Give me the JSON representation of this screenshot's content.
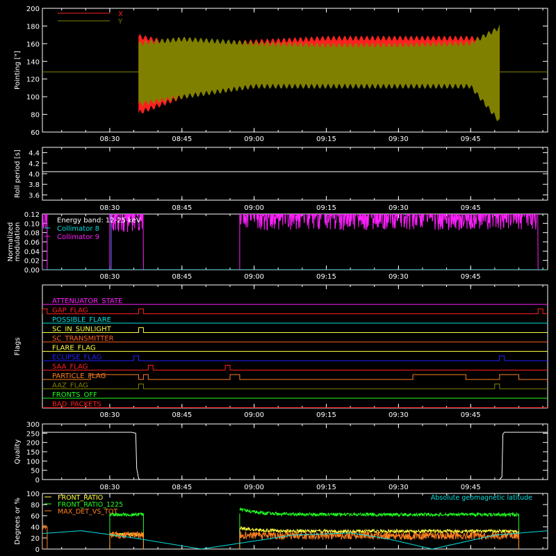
{
  "chart_data": [
    {
      "id": "pointing",
      "type": "line",
      "ylabel": "Pointing [\"]",
      "ylim": [
        60,
        200
      ],
      "yticks": [
        60,
        80,
        100,
        120,
        140,
        160,
        180,
        200
      ],
      "x_range": [
        "08:16",
        "10:01"
      ],
      "xticks": [
        "08:30",
        "08:45",
        "09:00",
        "09:15",
        "09:30",
        "09:45"
      ],
      "legend": {
        "placement": "top-left",
        "entries": [
          {
            "name": "X",
            "color": "#ff2020"
          },
          {
            "name": "Y",
            "color": "#808000"
          }
        ]
      },
      "series": [
        {
          "name": "X",
          "color": "#ff2020",
          "flat_value": 128,
          "active_start": "08:36",
          "active_end": "09:51",
          "envelope": [
            {
              "t": "08:36",
              "lo": 82,
              "hi": 168
            },
            {
              "t": "08:45",
              "lo": 100,
              "hi": 158
            },
            {
              "t": "09:00",
              "lo": 115,
              "hi": 162
            },
            {
              "t": "09:15",
              "lo": 120,
              "hi": 166
            },
            {
              "t": "09:30",
              "lo": 118,
              "hi": 166
            },
            {
              "t": "09:45",
              "lo": 118,
              "hi": 166
            },
            {
              "t": "09:51",
              "lo": 115,
              "hi": 162
            }
          ]
        },
        {
          "name": "Y",
          "color": "#808000",
          "flat_value": 128,
          "active_start": "08:36",
          "active_end": "09:51",
          "envelope": [
            {
              "t": "08:36",
              "lo": 92,
              "hi": 160
            },
            {
              "t": "08:45",
              "lo": 100,
              "hi": 165
            },
            {
              "t": "09:00",
              "lo": 112,
              "hi": 160
            },
            {
              "t": "09:15",
              "lo": 112,
              "hi": 158
            },
            {
              "t": "09:30",
              "lo": 112,
              "hi": 158
            },
            {
              "t": "09:45",
              "lo": 112,
              "hi": 160
            },
            {
              "t": "09:51",
              "lo": 72,
              "hi": 178
            }
          ]
        }
      ]
    },
    {
      "id": "roll",
      "type": "line",
      "ylabel": "Roll period [s]",
      "ylim": [
        3.5,
        4.5
      ],
      "yticks": [
        3.6,
        3.8,
        4.0,
        4.2,
        4.4
      ],
      "ytick_labels": [
        "3.6",
        "3.8",
        "4.0",
        "4.2",
        "4.4"
      ],
      "xticks": [
        "08:30",
        "08:45",
        "09:00",
        "09:15",
        "09:30",
        "09:45"
      ],
      "series": [
        {
          "name": "",
          "color": "#ffffff",
          "value": 4.04
        }
      ]
    },
    {
      "id": "modulation",
      "type": "line",
      "ylabel": "Normalized modulation",
      "ylabel_lines": [
        "Normalized",
        "modulation"
      ],
      "ylim": [
        0,
        0.12
      ],
      "yticks": [
        0,
        0.02,
        0.04,
        0.06,
        0.08,
        0.1,
        0.12
      ],
      "ytick_labels": [
        "0.00",
        "0.02",
        "0.04",
        "0.06",
        "0.08",
        "0.10",
        "0.12"
      ],
      "xticks": [
        "08:30",
        "08:45",
        "09:00",
        "09:15",
        "09:30",
        "09:45"
      ],
      "legend": {
        "placement": "top-left",
        "entries": [
          {
            "name": "Energy band: 12-25 keV",
            "color": "#ffffff"
          },
          {
            "name": "Collimator 8",
            "color": "#00e0e0"
          },
          {
            "name": "Collimator 9",
            "color": "#ff20ff"
          }
        ]
      },
      "segments": [
        {
          "series": "Collimator 9",
          "color": "#ff20ff",
          "start": "08:16",
          "end": "08:17",
          "lo": 0.085,
          "hi": 0.12
        },
        {
          "series": "Collimator 9",
          "color": "#ff20ff",
          "start": "08:30",
          "end": "08:37",
          "lo": 0.08,
          "hi": 0.12
        },
        {
          "series": "Collimator 9",
          "color": "#ff20ff",
          "start": "08:57",
          "end": "09:59",
          "lo": 0.085,
          "hi": 0.12
        },
        {
          "series": "Collimator 8",
          "color": "#00e0e0",
          "start": "08:16",
          "end": "10:01",
          "value": 0.0
        }
      ]
    },
    {
      "id": "flags",
      "type": "line",
      "ylabel": "Flags",
      "xticks": [
        "08:30",
        "08:45",
        "09:00",
        "09:15",
        "09:30",
        "09:45"
      ],
      "flags": [
        {
          "name": "ATTENUATOR_STATE",
          "color": "#ff20ff",
          "transitions": []
        },
        {
          "name": "GAP_FLAG",
          "color": "#ff2020",
          "transitions": [
            "08:16",
            "08:17",
            "08:36",
            "08:37",
            "09:59",
            "10:00"
          ]
        },
        {
          "name": "POSSIBLE_FLARE",
          "color": "#00e0e0",
          "transitions": []
        },
        {
          "name": "SC_IN_SUNLIGHT",
          "color": "#ffff40",
          "transitions": [
            "08:36",
            "08:37"
          ]
        },
        {
          "name": "SC_TRANSMITTER",
          "color": "#ff6020",
          "transitions": []
        },
        {
          "name": "FLARE_FLAG",
          "color": "#ffff40",
          "transitions": []
        },
        {
          "name": "ECLIPSE_FLAG",
          "color": "#2020ff",
          "transitions": [
            "08:35",
            "08:36",
            "09:51",
            "09:52"
          ]
        },
        {
          "name": "SAA_FLAG",
          "color": "#ff2020",
          "transitions": [
            "08:38",
            "08:39",
            "08:54",
            "08:55"
          ]
        },
        {
          "name": "PARTICLE_FLAG",
          "color": "#ff8020",
          "transitions": [
            "08:26",
            "08:36",
            "08:37",
            "08:38",
            "08:55",
            "08:57",
            "09:33",
            "09:44",
            "09:51",
            "09:55"
          ]
        },
        {
          "name": "AAZ_FLAG",
          "color": "#808000",
          "transitions": [
            "08:36",
            "08:37",
            "09:50",
            "09:51"
          ]
        },
        {
          "name": "FRONTS_OFF",
          "color": "#20ff20",
          "transitions": []
        },
        {
          "name": "BAD_PACKETS",
          "color": "#ff2020",
          "transitions": []
        }
      ]
    },
    {
      "id": "quality",
      "type": "line",
      "ylabel": "Quality",
      "ylim": [
        0,
        300
      ],
      "yticks": [
        0,
        50,
        100,
        150,
        200,
        250,
        300
      ],
      "ytick_labels": [
        "0",
        "50",
        "100",
        "150",
        "200",
        "250",
        "300"
      ],
      "xticks": [
        "08:30",
        "08:45",
        "09:00",
        "09:15",
        "09:30",
        "09:45"
      ],
      "series": [
        {
          "name": "",
          "color": "#ffffff",
          "points": [
            {
              "t": "08:16",
              "y": 255
            },
            {
              "t": "08:34.5",
              "y": 255
            },
            {
              "t": "08:35.4",
              "y": 250
            },
            {
              "t": "08:35.6",
              "y": 60
            },
            {
              "t": "08:36",
              "y": 5
            },
            {
              "t": "08:36.3",
              "y": 0
            },
            {
              "t": "09:51",
              "y": 0
            },
            {
              "t": "09:51.5",
              "y": 15
            },
            {
              "t": "09:51.7",
              "y": 245
            },
            {
              "t": "09:52",
              "y": 255
            },
            {
              "t": "10:01",
              "y": 255
            }
          ]
        }
      ]
    },
    {
      "id": "ratios",
      "type": "line",
      "ylabel": "Degrees or %",
      "ylim": [
        0,
        100
      ],
      "yticks": [
        0,
        20,
        40,
        60,
        80,
        100
      ],
      "ytick_labels": [
        "0",
        "20",
        "40",
        "60",
        "80",
        "100"
      ],
      "xticks": [
        "08:30",
        "08:45",
        "09:00",
        "09:15",
        "09:30",
        "09:45"
      ],
      "legend": {
        "placement": "top-left",
        "entries": [
          {
            "name": "FRONT_RATIO",
            "color": "#ffff40"
          },
          {
            "name": "FRONT_RATIO_1225",
            "color": "#20ff20"
          },
          {
            "name": "MAX_DET_VS_TOT",
            "color": "#ff8020"
          }
        ]
      },
      "annotation": {
        "text": "Absolute geomagnetic latitude",
        "color": "#00e0e0",
        "placement": "top-right"
      },
      "series": [
        {
          "name": "FRONT_RATIO_1225",
          "color": "#20ff20",
          "segments": [
            {
              "start": "08:30",
              "end": "08:37",
              "level": 62,
              "noise": 3
            },
            {
              "start": "08:57",
              "end": "09:55",
              "level": 62,
              "noise": 3,
              "start_level": 72
            }
          ]
        },
        {
          "name": "FRONT_RATIO",
          "color": "#ffff40",
          "segments": [
            {
              "start": "08:30",
              "end": "08:37",
              "level": 26,
              "noise": 3
            },
            {
              "start": "08:57",
              "end": "09:55",
              "level": 32,
              "noise": 3,
              "start_level": 38
            }
          ]
        },
        {
          "name": "MAX_DET_VS_TOT",
          "color": "#ff8020",
          "segments": [
            {
              "start": "08:16",
              "end": "08:17",
              "level": 38,
              "noise": 6
            },
            {
              "start": "08:30",
              "end": "08:37",
              "level": 25,
              "noise": 6
            },
            {
              "start": "08:57",
              "end": "09:55",
              "level": 24,
              "noise": 7
            }
          ]
        },
        {
          "name": "Absolute geomagnetic latitude",
          "color": "#00e0e0",
          "points": [
            {
              "t": "08:16",
              "y": 28
            },
            {
              "t": "08:24",
              "y": 33
            },
            {
              "t": "08:35",
              "y": 20
            },
            {
              "t": "08:49",
              "y": 0
            },
            {
              "t": "09:02",
              "y": 17
            },
            {
              "t": "09:08",
              "y": 25
            },
            {
              "t": "09:20",
              "y": 29
            },
            {
              "t": "09:28",
              "y": 18
            },
            {
              "t": "09:37",
              "y": 0
            },
            {
              "t": "09:50",
              "y": 25
            },
            {
              "t": "10:01",
              "y": 33
            }
          ]
        }
      ]
    }
  ]
}
